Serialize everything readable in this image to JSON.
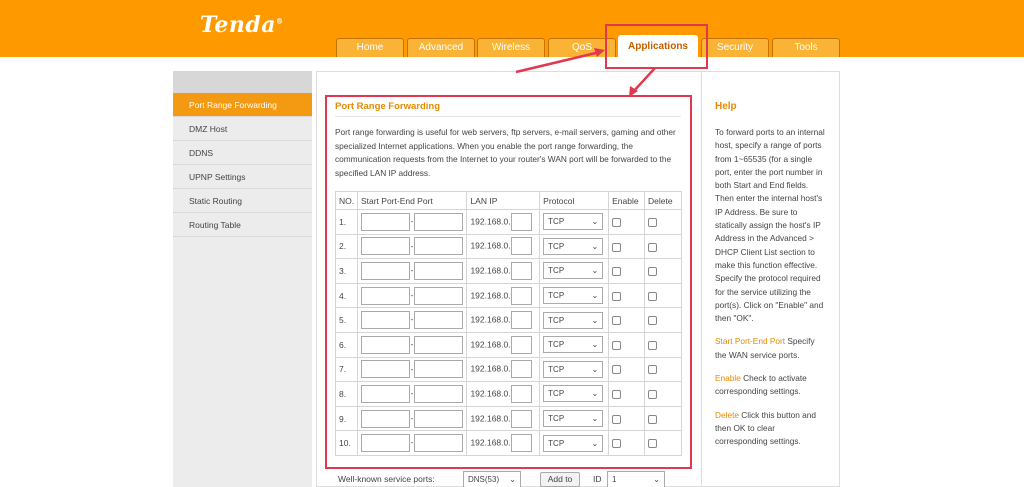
{
  "brand": {
    "logo": "Tenda",
    "mark": "®"
  },
  "nav": {
    "tabs": [
      "Home",
      "Advanced",
      "Wireless",
      "QoS",
      "Applications",
      "Security",
      "Tools"
    ],
    "active": "Applications"
  },
  "sidebar": {
    "items": [
      "Port Range Forwarding",
      "DMZ Host",
      "DDNS",
      "UPNP Settings",
      "Static Routing",
      "Routing Table"
    ],
    "active": "Port Range Forwarding"
  },
  "main": {
    "title": "Port Range Forwarding",
    "description": "Port range forwarding is useful for web servers, ftp servers, e-mail servers, gaming and other specialized Internet applications. When you enable the port range forwarding, the communication requests from the Internet to your router's WAN port will be forwarded to the specified LAN IP address.",
    "table": {
      "headers": [
        "NO.",
        "Start Port-End Port",
        "LAN IP",
        "Protocol",
        "Enable",
        "Delete"
      ],
      "rows": [
        {
          "no": "1.",
          "ip_prefix": "192.168.0.",
          "protocol": "TCP"
        },
        {
          "no": "2.",
          "ip_prefix": "192.168.0.",
          "protocol": "TCP"
        },
        {
          "no": "3.",
          "ip_prefix": "192.168.0.",
          "protocol": "TCP"
        },
        {
          "no": "4.",
          "ip_prefix": "192.168.0.",
          "protocol": "TCP"
        },
        {
          "no": "5.",
          "ip_prefix": "192.168.0.",
          "protocol": "TCP"
        },
        {
          "no": "6.",
          "ip_prefix": "192.168.0.",
          "protocol": "TCP"
        },
        {
          "no": "7.",
          "ip_prefix": "192.168.0.",
          "protocol": "TCP"
        },
        {
          "no": "8.",
          "ip_prefix": "192.168.0.",
          "protocol": "TCP"
        },
        {
          "no": "9.",
          "ip_prefix": "192.168.0.",
          "protocol": "TCP"
        },
        {
          "no": "10.",
          "ip_prefix": "192.168.0.",
          "protocol": "TCP"
        }
      ]
    },
    "wellknown": {
      "label": "Well-known service ports:",
      "service": "DNS(53)",
      "add_button": "Add to",
      "id_label": "ID",
      "id_value": "1"
    }
  },
  "help": {
    "title": "Help",
    "intro": "To forward ports to an internal host, specify a range of ports from 1~65535 (for a single port, enter the port number in both Start and End fields. Then enter the internal host's IP Address. Be sure to statically assign the host's IP Address in the Advanced > DHCP Client List section to make this function effective. Specify the protocol required for the service utilizing the port(s). Click on \"Enable\" and then \"OK\".",
    "items": [
      {
        "term": "Start Port-End Port",
        "text": " Specify the WAN service ports."
      },
      {
        "term": "Enable",
        "text": " Check to activate corresponding settings."
      },
      {
        "term": "Delete",
        "text": " Click this button and then OK to clear corresponding settings."
      }
    ]
  },
  "colors": {
    "header": "#ff9900",
    "accent": "#e68a00",
    "highlight_box": "#e0394f"
  },
  "icons": [
    "chevron-down-icon",
    "arrow-icon"
  ]
}
